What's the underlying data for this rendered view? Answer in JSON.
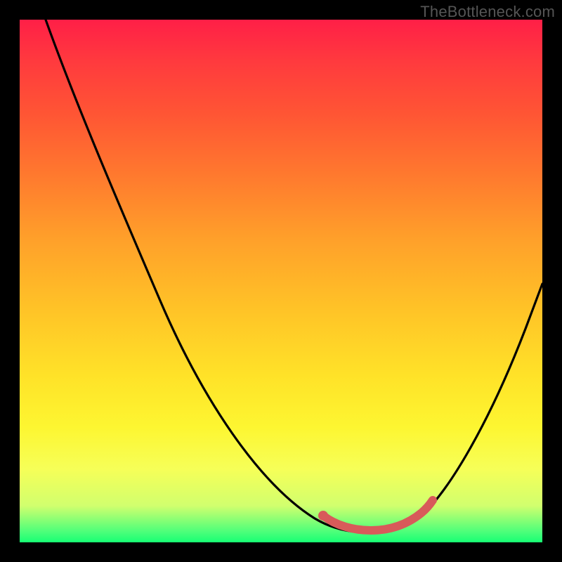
{
  "watermark": "TheBottleneck.com",
  "gradient": {
    "top": "#ff1f47",
    "mid": "#ffe228",
    "bottom": "#17ff74"
  },
  "chart_data": {
    "type": "line",
    "title": "",
    "xlabel": "",
    "ylabel": "",
    "xlim": [
      0,
      100
    ],
    "ylim": [
      0,
      100
    ],
    "grid": false,
    "legend": false,
    "series": [
      {
        "name": "bottleneck-curve",
        "color": "#000000",
        "x": [
          5,
          15,
          25,
          35,
          45,
          55,
          61,
          67,
          73,
          80,
          88,
          96,
          100
        ],
        "y": [
          100,
          82,
          62,
          44,
          28,
          13,
          5,
          2,
          2,
          4,
          15,
          36,
          51
        ]
      },
      {
        "name": "highlight-segment",
        "color": "#e06060",
        "x": [
          61,
          65,
          69,
          73,
          77,
          79
        ],
        "y": [
          4,
          2.5,
          2,
          2.5,
          4,
          6
        ]
      }
    ],
    "annotations": []
  }
}
